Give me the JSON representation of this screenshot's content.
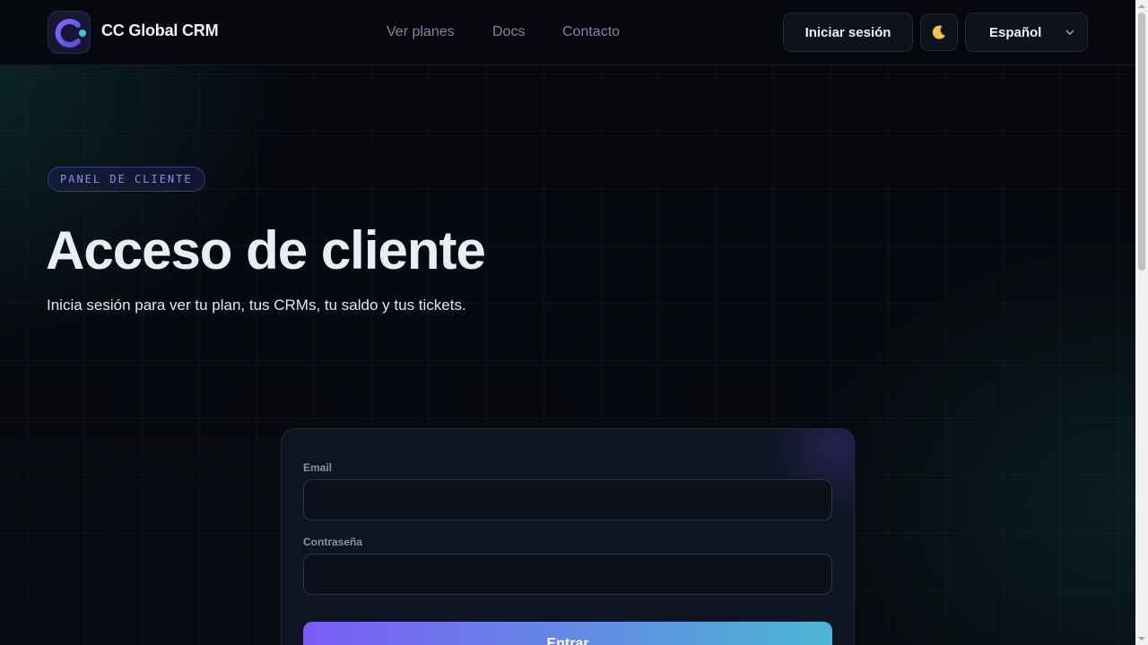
{
  "header": {
    "brand": "CC Global CRM",
    "nav": [
      {
        "label": "Ver planes"
      },
      {
        "label": "Docs"
      },
      {
        "label": "Contacto"
      }
    ],
    "login_label": "Iniciar sesión",
    "theme_icon": "moon-icon",
    "language": "Español"
  },
  "hero": {
    "badge": "PANEL DE CLIENTE",
    "title": "Acceso de cliente",
    "subtitle": "Inicia sesión para ver tu plan, tus CRMs, tu saldo y tus tickets."
  },
  "form": {
    "email_label": "Email",
    "email_value": "",
    "password_label": "Contraseña",
    "password_value": "",
    "submit_label": "Entrar"
  },
  "colors": {
    "accent_purple": "#7b5cf5",
    "accent_cyan": "#4bb6d4",
    "background": "#06080e"
  }
}
